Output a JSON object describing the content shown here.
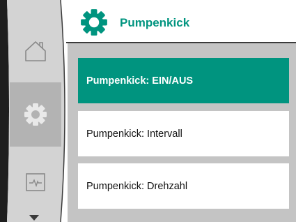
{
  "header": {
    "title": "Pumpenkick",
    "icon": "gear-icon",
    "accent_color": "#00947f"
  },
  "nav": {
    "items": [
      {
        "name": "home",
        "icon": "home-icon"
      },
      {
        "name": "settings",
        "icon": "gear-icon",
        "active": true
      },
      {
        "name": "status",
        "icon": "pulse-icon"
      }
    ],
    "scroll_icon": "chevron-down-icon"
  },
  "menu": {
    "items": [
      {
        "label": "Pumpenkick: EIN/AUS",
        "selected": true
      },
      {
        "label": "Pumpenkick: Intervall",
        "selected": false
      },
      {
        "label": "Pumpenkick: Drehzahl",
        "selected": false
      }
    ]
  }
}
